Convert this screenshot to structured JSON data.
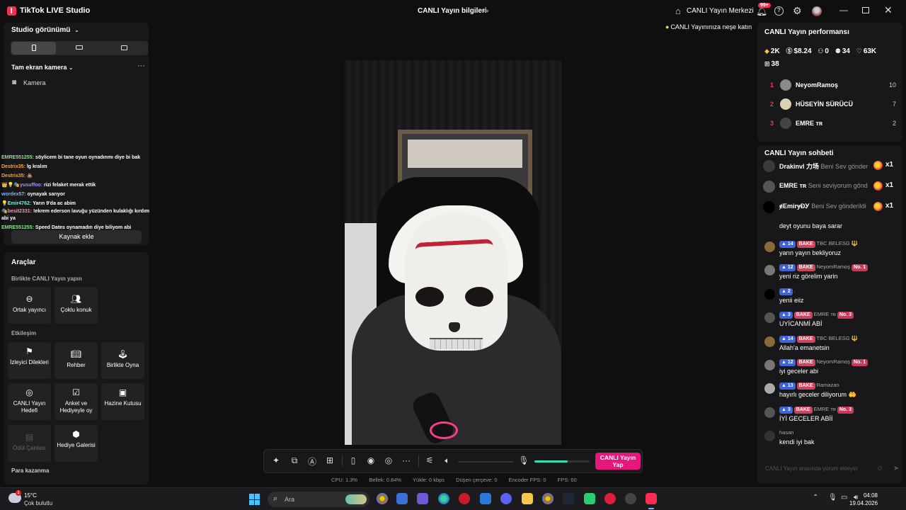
{
  "titlebar": {
    "app_title": "TikTok LIVE Studio",
    "stream_title": "CANLI Yayın bilgileri",
    "live_center": "CANLI Yayın Merkezi",
    "notif_badge": "99+"
  },
  "left": {
    "studio_view": "Studio görünümü",
    "fullscreen_camera": "Tam ekran kamera",
    "camera": "Kamera",
    "add_source": "Kaynak ekle",
    "overlay_chat": [
      {
        "user": "EMRE551255:",
        "text": "söylicem bi tane oyun oynadınmı diye bi bak",
        "color": "#8fe08a"
      },
      {
        "user": "Destrix35:",
        "text": "lg kralım",
        "color": "#f2a54a"
      },
      {
        "user": "Destrix35:",
        "text": "💩",
        "color": "#f2a54a"
      },
      {
        "user": "👑💡🎭yusuffoo:",
        "text": "rizi felaket merak ettik",
        "color": "#b08cff"
      },
      {
        "user": "wordex57:",
        "text": "oynayak sarıyor",
        "color": "#7fb3ff"
      },
      {
        "user": "💡Emir4762:",
        "text": "Yarın 9'da ac abim",
        "color": "#8fe0d0"
      },
      {
        "user": "🎭besit2331:",
        "text": "!ekrem ederson lavuğu yüzünden kulaklığı kırdım abi ya",
        "color": "#ff8fb0"
      },
      {
        "user": "EMRE551255:",
        "text": "Speed Dates oynamadın diye biliyom abi",
        "color": "#8fe08a"
      }
    ],
    "tools_title": "Araçlar",
    "cat_cohost": "Birlikte CANLI Yayın yapın",
    "cat_interaction": "Etkileşim",
    "cat_earn": "Para kazanma",
    "tools": {
      "cohost": "Ortak yayıncı",
      "multi_guest": "Çoklu konuk",
      "viewer_wishes": "İzleyici Dilekleri",
      "guide": "Rehber",
      "play_together": "Birlikte Oyna",
      "live_goal": "CANLI Yayın Hedefi",
      "poll": "Anket ve Hediyeyle oy",
      "treasure": "Hazine Kutusu",
      "reward_bag": "Ödül Çantası",
      "gift_gallery": "Hediye Galerisi"
    }
  },
  "center": {
    "promo": "CANLI Yayınınıza neşe katın",
    "go_live": "CANLI Yayın Yap",
    "mic_level": 0.6,
    "stats": {
      "cpu": "CPU:  1.3%",
      "memory": "Bellek:  0.84%",
      "upload": "Yükle:  0 kbps",
      "dropped": "Düşen çerçeve:  0",
      "encoder": "Encoder FPS:  0",
      "fps": "FPS:  60"
    }
  },
  "right": {
    "perf_title": "CANLI Yayın performansı",
    "perf": {
      "diamonds": "2K",
      "earnings": "$8.24",
      "new_followers": "0",
      "viewers": "34",
      "likes": "63K",
      "gifters": "38"
    },
    "ranking": [
      {
        "rank": "1",
        "name": "NeyomRamoş",
        "score": "10"
      },
      {
        "rank": "2",
        "name": "HÜSEYİN SÜRÜCÜ",
        "score": "7"
      },
      {
        "rank": "3",
        "name": "EMRE ᴛʀ",
        "score": "2"
      }
    ],
    "chat_title": "CANLI Yayın sohbeti",
    "gifts": [
      {
        "name": "Drakinvl 力场",
        "msg": "Beni Sev gönder",
        "count": "x1"
      },
      {
        "name": "EMRE ᴛʀ",
        "msg": "Seni seviyorum gönd",
        "count": "x1"
      },
      {
        "name": "ɇEmirɏĐᎩ",
        "msg": "Beni Sev gönderildi",
        "count": "x1"
      }
    ],
    "messages": [
      {
        "level": "",
        "fan": "",
        "name": "",
        "rank": "",
        "text": "deyt oyunu baya sarar"
      },
      {
        "level": "14",
        "fan": "BAKE",
        "name": "TBC BELESG 🔱",
        "rank": "",
        "text": "yarın yayın bekliyoruz"
      },
      {
        "level": "12",
        "fan": "BAKE",
        "name": "NeyomRamoş",
        "rank": "No. 1",
        "text": "yeni riz görelim yarin"
      },
      {
        "level": "2",
        "fan": "",
        "name": ".",
        "rank": "",
        "text": "yenii eiiz"
      },
      {
        "level": "3",
        "fan": "BAKE",
        "name": "EMRE ᴛʀ",
        "rank": "No. 3",
        "text": "UYİCANMİ ABİ"
      },
      {
        "level": "14",
        "fan": "BAKE",
        "name": "TBC BELESG 🔱",
        "rank": "",
        "text": "Allah'a emanetsin"
      },
      {
        "level": "12",
        "fan": "BAKE",
        "name": "NeyomRamoş",
        "rank": "No. 1",
        "text": "iyi geceler abi"
      },
      {
        "level": "13",
        "fan": "BAKE",
        "name": "Ramazan",
        "rank": "",
        "text": "hayırlı geceler diliyorum 🤲"
      },
      {
        "level": "3",
        "fan": "BAKE",
        "name": "EMRE ᴛʀ",
        "rank": "No. 3",
        "text": "İYİ GECELER ABİİ"
      },
      {
        "level": "",
        "fan": "",
        "name": "hasan",
        "rank": "",
        "text": "kendi iyi bak"
      }
    ],
    "chat_placeholder": "CANLI Yayın arasında yorum ekleyin"
  },
  "taskbar": {
    "temp": "15°C",
    "condition": "Çok bulutlu",
    "weather_badge": "1",
    "search_placeholder": "Ara",
    "time": "04:08",
    "date": "19.04.2026"
  },
  "colors": {
    "accent": "#fe2c55",
    "go_live": "#e7167b",
    "mic": "#2fe0b5",
    "level_badge": "#3e64d8",
    "fan_badge": "#c9465e"
  }
}
